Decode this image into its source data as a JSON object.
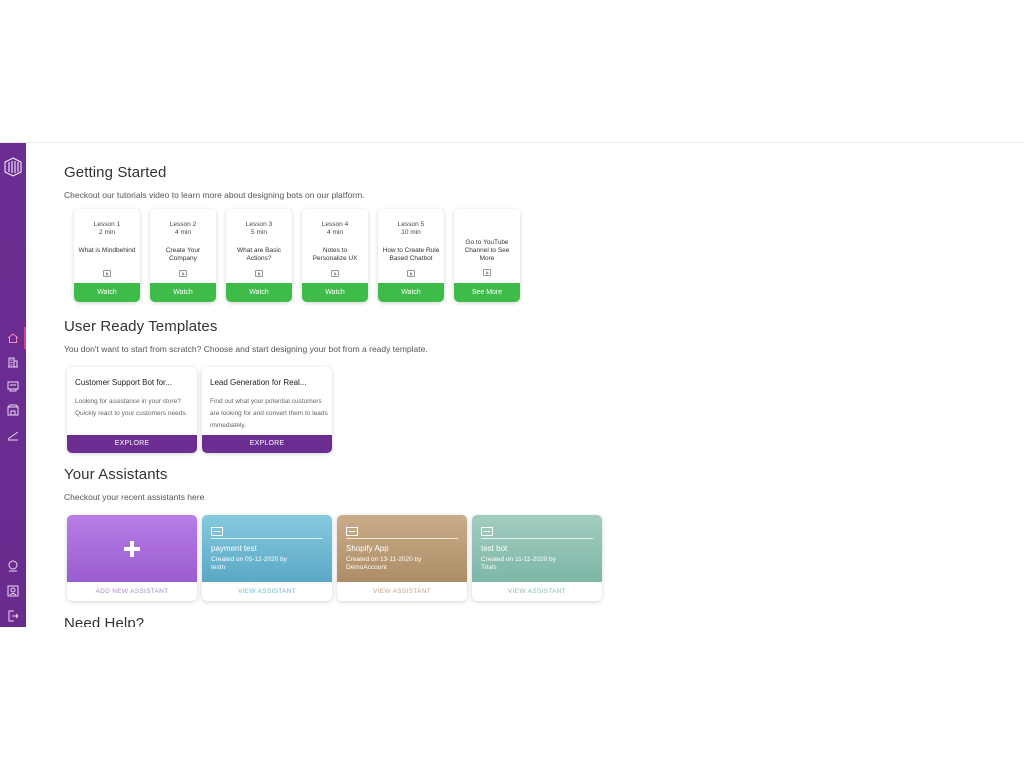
{
  "getting_started": {
    "title": "Getting Started",
    "subtitle": "Checkout our tutorials video to learn more about designing bots on our platform.",
    "lessons": [
      {
        "number": "Lesson 1",
        "duration": "2 min",
        "title": "What is Mindbehind",
        "button": "Watch"
      },
      {
        "number": "Lesson 2",
        "duration": "4 min",
        "title": "Create Your Company",
        "button": "Watch"
      },
      {
        "number": "Lesson 3",
        "duration": "5 min",
        "title": "What are Basic Actions?",
        "button": "Watch"
      },
      {
        "number": "Lesson 4",
        "duration": "4 min",
        "title": "Notes to Personalize UX",
        "button": "Watch"
      },
      {
        "number": "Lesson 5",
        "duration": "10 min",
        "title": "How to Create Rule Based Chatbot",
        "button": "Watch"
      }
    ],
    "more": {
      "title": "Go to YouTube Channel to See More",
      "button": "See More"
    }
  },
  "templates": {
    "title": "User Ready Templates",
    "subtitle": "You don't want to start from scratch? Choose and start designing your bot from a ready template.",
    "items": [
      {
        "title": "Customer Support Bot for...",
        "description": "Looking for assistance in your store? Quickly react to your customers needs.",
        "button": "EXPLORE"
      },
      {
        "title": "Lead Generation for Real...",
        "description": "Find out what your potential customers are looking for and convert them to leads immediately.",
        "button": "EXPLORE"
      }
    ]
  },
  "assistants": {
    "title": "Your Assistants",
    "subtitle": "Checkout your recent assistants here",
    "add_label": "ADD NEW ASSISTANT",
    "items": [
      {
        "name": "payment test",
        "created": "Created on 05-12-2020 by",
        "by": "testn",
        "link": "VIEW ASSISTANT"
      },
      {
        "name": "Shopify App",
        "created": "Created on 13-11-2020 by",
        "by": "DemoAccount",
        "link": "VIEW ASSISTANT"
      },
      {
        "name": "test bot",
        "created": "Created on 11-11-2020 by",
        "by": "Trials",
        "link": "VIEW ASSISTANT"
      }
    ]
  },
  "help": {
    "title": "Need Help?"
  },
  "colors": {
    "sidebar": "#6b2d91",
    "watch_green": "#3fbb49",
    "explore_purple": "#6b2d91",
    "add_purple": "#b476e0",
    "payment_teal": "#6db6cf",
    "shopify_tan": "#bfa079",
    "testbot_green": "#8fc4b5"
  },
  "sidebar_icons": [
    "logo-icon",
    "home-icon",
    "building-icon",
    "bots-icon",
    "store-icon",
    "analytics-icon",
    "help-icon",
    "contact-icon",
    "logout-icon"
  ]
}
